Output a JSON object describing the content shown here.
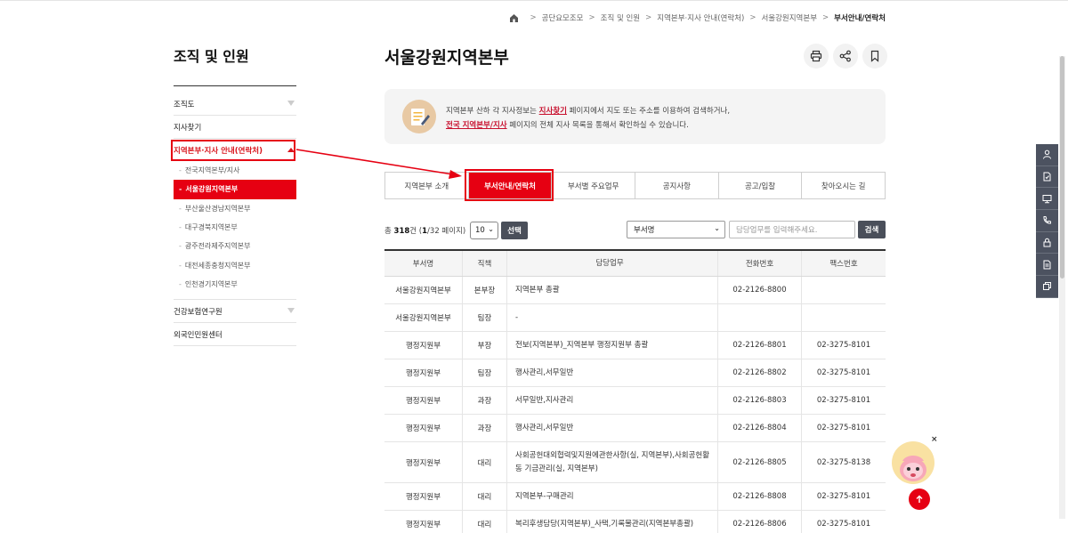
{
  "breadcrumb": {
    "items": [
      "공단요모조모",
      "조직 및 인원",
      "지역본부·지사 안내(연락처)",
      "서울강원지역본부",
      "부서안내/연락처"
    ],
    "separator": ">"
  },
  "sidebar": {
    "title": "조직 및 인원",
    "items": [
      {
        "label": "조직도"
      },
      {
        "label": "지사찾기"
      },
      {
        "label": "지역본부·지사 안내(연락처)"
      }
    ],
    "subitems": [
      {
        "label": "전국지역본부/지사"
      },
      {
        "label": "서울강원지역본부"
      },
      {
        "label": "부산울산경남지역본부"
      },
      {
        "label": "대구경북지역본부"
      },
      {
        "label": "광주전라제주지역본부"
      },
      {
        "label": "대전세종충청지역본부"
      },
      {
        "label": "인천경기지역본부"
      }
    ],
    "items2": [
      {
        "label": "건강보험연구원"
      },
      {
        "label": "외국인민원센터"
      }
    ]
  },
  "page": {
    "title": "서울강원지역본부",
    "tools": [
      "print-icon",
      "share-icon",
      "bookmark-icon"
    ]
  },
  "info": {
    "line1_pre": "지역본부 산하 각 지사정보는 ",
    "line1_link": "지사찾기",
    "line1_post": " 페이지에서 지도 또는 주소를 이용하여 검색하거나,",
    "line2_link": "전국 지역본부/지사",
    "line2_post": " 페이지의 전체 지사 목록을 통해서 확인하실 수 있습니다."
  },
  "tabs": [
    {
      "label": "지역본부 소개"
    },
    {
      "label": "부서안내/연락처"
    },
    {
      "label": "부서별 주요업무"
    },
    {
      "label": "공지사항"
    },
    {
      "label": "공고/입찰"
    },
    {
      "label": "찾아오시는 길"
    }
  ],
  "search": {
    "count_pre": "총 ",
    "count_total": "318",
    "count_mid": "건 (",
    "count_page": "1",
    "count_post": "/32 페이지)",
    "per_page": "10",
    "select_button": "선택",
    "dept_select": "부서명",
    "placeholder": "담당업무를 입력해주세요.",
    "search_button": "검색"
  },
  "table": {
    "headers": [
      "부서명",
      "직책",
      "담당업무",
      "전화번호",
      "팩스번호"
    ],
    "rows": [
      [
        "서울강원지역본부",
        "본부장",
        "지역본부 총괄",
        "02-2126-8800",
        ""
      ],
      [
        "서울강원지역본부",
        "팀장",
        "-",
        "",
        ""
      ],
      [
        "행정지원부",
        "부장",
        "전보(지역본부)_지역본부 행정지원부 총괄",
        "02-2126-8801",
        "02-3275-8101"
      ],
      [
        "행정지원부",
        "팀장",
        "행사관리,서무일반",
        "02-2126-8802",
        "02-3275-8101"
      ],
      [
        "행정지원부",
        "과장",
        "서무일반,지사관리",
        "02-2126-8803",
        "02-3275-8101"
      ],
      [
        "행정지원부",
        "과장",
        "행사관리,서무일반",
        "02-2126-8804",
        "02-3275-8101"
      ],
      [
        "행정지원부",
        "대리",
        "사회공헌대외협력및지원에관한사항(실, 지역본부),사회공헌활동 기금관리(실, 지역본부)",
        "02-2126-8805",
        "02-3275-8138"
      ],
      [
        "행정지원부",
        "대리",
        "지역본부-구매관리",
        "02-2126-8808",
        "02-3275-8101"
      ],
      [
        "행정지원부",
        "대리",
        "복리후생담당(지역본부)_사택,기록물관리(지역본부총괄)",
        "02-2126-8806",
        "02-3275-8101"
      ]
    ]
  },
  "quick_menu": [
    "person-icon",
    "document-icon",
    "monitor-icon",
    "phone-icon",
    "lock-icon",
    "file-icon",
    "copy-icon"
  ],
  "colors": {
    "accent": "#e60012",
    "dark_button": "#4a4f5a",
    "quick_menu": "#4c5260"
  }
}
